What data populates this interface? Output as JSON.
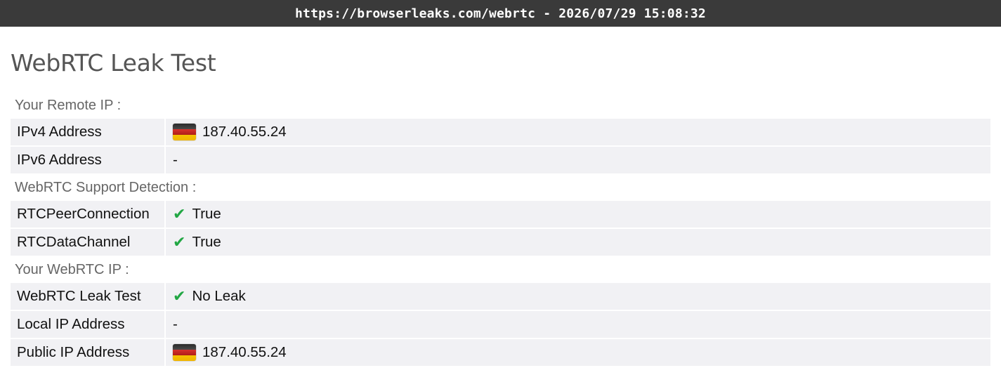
{
  "browser": {
    "url_bar": "https://browserleaks.com/webrtc - 2026/07/29 15:08:32"
  },
  "page": {
    "title": "WebRTC Leak Test"
  },
  "sections": [
    {
      "label": "Your Remote IP :",
      "rows": [
        {
          "key": "IPv4 Address",
          "value": "187.40.55.24",
          "icon": "germany-flag-icon"
        },
        {
          "key": "IPv6 Address",
          "value": "-"
        }
      ]
    },
    {
      "label": "WebRTC Support Detection :",
      "rows": [
        {
          "key": "RTCPeerConnection",
          "value": "True",
          "icon": "check-icon"
        },
        {
          "key": "RTCDataChannel",
          "value": "True",
          "icon": "check-icon"
        }
      ]
    },
    {
      "label": "Your WebRTC IP :",
      "rows": [
        {
          "key": "WebRTC Leak Test",
          "value": "No Leak",
          "icon": "check-icon"
        },
        {
          "key": "Local IP Address",
          "value": "-"
        },
        {
          "key": "Public IP Address",
          "value": "187.40.55.24",
          "icon": "germany-flag-icon"
        }
      ]
    }
  ],
  "icons": {
    "check_glyph": "✔"
  },
  "colors": {
    "check": "#22a744",
    "topbar": "#3a3a3a",
    "row_bg": "#f1f1f4",
    "title": "#555555"
  }
}
